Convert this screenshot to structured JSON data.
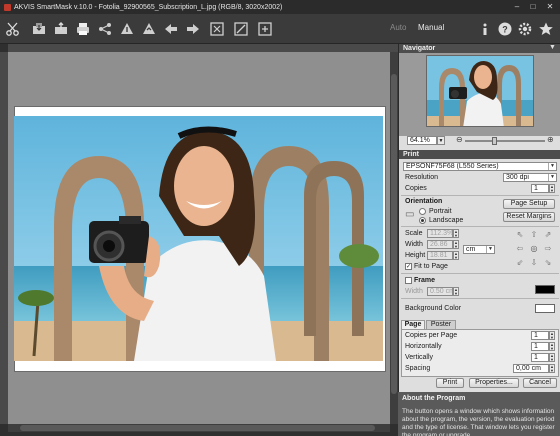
{
  "window": {
    "title": "AKVIS SmartMask v.10.0 - Fotolia_92900565_Subscription_L.jpg (RGB/8, 3020x2002)",
    "controls": [
      "–",
      "□",
      "✕"
    ]
  },
  "toolbar": {
    "left_tools": [
      "scissors-icon",
      "open-icon",
      "save-icon",
      "print-icon",
      "share-icon",
      "import-strokes-icon",
      "export-strokes-icon",
      "clear-icon",
      "undo-icon",
      "redo-icon",
      "fit-icon",
      "zoom-icon",
      "hand-icon"
    ],
    "mode_auto": "Auto",
    "mode_manual": "Manual",
    "right_tools": [
      "info-icon",
      "help-icon",
      "settings-icon",
      "favorites-icon"
    ]
  },
  "navigator": {
    "title": "Navigator",
    "zoom": "64.1%",
    "zoom_level": 0.35
  },
  "print": {
    "title": "Print",
    "printer": "EPSONF75F68 (L550 Series)",
    "resolution_label": "Resolution",
    "resolution": "300 dpi",
    "copies_label": "Copies",
    "copies": "1",
    "orientation_label": "Orientation",
    "portrait": "Portrait",
    "landscape": "Landscape",
    "page_setup": "Page Setup",
    "reset_margins": "Reset Margins",
    "scale_label": "Scale",
    "scale": "112.3%",
    "width_label": "Width",
    "width": "26.86",
    "height_label": "Height",
    "height": "18.81",
    "unit": "cm",
    "fit_to_page": "Fit to Page",
    "frame_label": "Frame",
    "frame_width_label": "Width",
    "frame_width": "0.50 cm",
    "frame_color": "#000000",
    "background_color_label": "Background Color",
    "background_color": "#ffffff"
  },
  "tabs": {
    "page": "Page",
    "poster": "Poster",
    "copies_per_page_label": "Copies per Page",
    "copies_per_page": "1",
    "horizontally_label": "Horizontally",
    "horizontally": "1",
    "vertically_label": "Vertically",
    "vertically": "1",
    "spacing_label": "Spacing",
    "spacing": "0,00 cm"
  },
  "actions": {
    "print": "Print",
    "properties": "Properties...",
    "cancel": "Cancel"
  },
  "about": {
    "title": "About the Program",
    "text": "The button opens a window which shows information about the program, the version, the evaluation period and the type of license. That window lets you register the program or upgrade"
  }
}
